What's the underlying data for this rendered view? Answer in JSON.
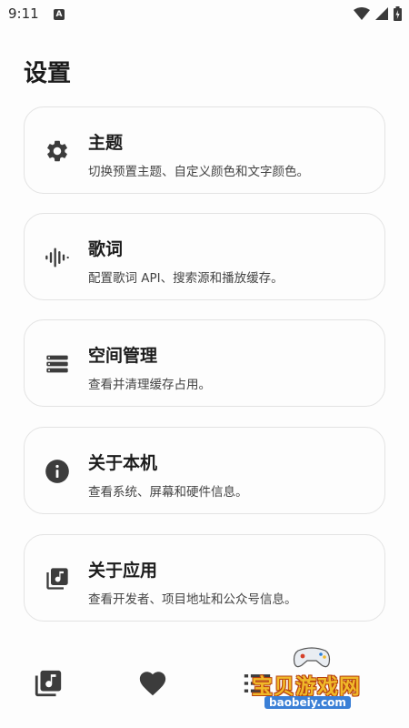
{
  "status_bar": {
    "time": "9:11",
    "indicator": "A",
    "icons": [
      "wifi-icon",
      "signal-icon",
      "battery-icon"
    ]
  },
  "page": {
    "title": "设置"
  },
  "settings": [
    {
      "title": "主题",
      "desc": "切换预置主题、自定义颜色和文字颜色。",
      "icon": "gear-icon"
    },
    {
      "title": "歌词",
      "desc": "配置歌词 API、搜索源和播放缓存。",
      "icon": "waveform-icon"
    },
    {
      "title": "空间管理",
      "desc": "查看并清理缓存占用。",
      "icon": "storage-icon"
    },
    {
      "title": "关于本机",
      "desc": "查看系统、屏幕和硬件信息。",
      "icon": "info-icon"
    },
    {
      "title": "关于应用",
      "desc": "查看开发者、项目地址和公众号信息。",
      "icon": "music-library-icon"
    }
  ],
  "bottom_nav": [
    "music-library-icon",
    "heart-icon",
    "list-icon"
  ],
  "watermark": {
    "text": "宝贝游戏网",
    "domain": "baobeiy.com"
  },
  "colors": {
    "icon": "#3c3c3c",
    "card_border": "#e3e3e3",
    "background": "#fdfdfd"
  }
}
